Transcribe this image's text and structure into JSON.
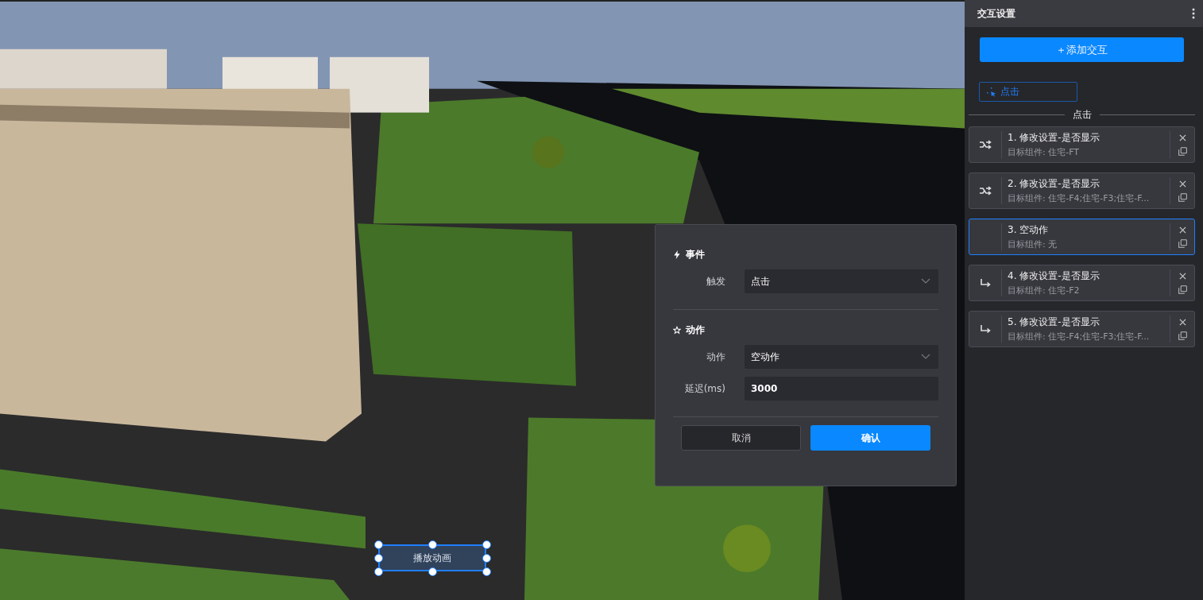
{
  "canvas_button": {
    "label": "播放动画",
    "selected": true
  },
  "dialog": {
    "event_section": "事件",
    "trigger_label": "触发",
    "trigger_value": "点击",
    "action_section": "动作",
    "action_label": "动作",
    "action_value": "空动作",
    "delay_label": "延迟(ms)",
    "delay_value": "3000",
    "buttons": [
      {
        "label": "取消",
        "kind": "secondary"
      },
      {
        "label": "确认",
        "kind": "primary"
      }
    ]
  },
  "panel": {
    "title": "交互设置",
    "add_button": "＋添加交互",
    "trigger_chip": "点击",
    "group_label": "点击",
    "actions": [
      {
        "kind": "branch",
        "title": "1. 修改设置-是否显示",
        "target": "目标组件: 住宅-FT",
        "selected": false
      },
      {
        "kind": "branch",
        "title": "2. 修改设置-是否显示",
        "target": "目标组件: 住宅-F4;住宅-F3;住宅-F...",
        "selected": false
      },
      {
        "kind": "none",
        "title": "3. 空动作",
        "target": "目标组件: 无",
        "selected": true
      },
      {
        "kind": "turn",
        "title": "4. 修改设置-是否显示",
        "target": "目标组件: 住宅-F2",
        "selected": false
      },
      {
        "kind": "turn",
        "title": "5. 修改设置-是否显示",
        "target": "目标组件: 住宅-F4;住宅-F3;住宅-F...",
        "selected": false
      }
    ]
  }
}
